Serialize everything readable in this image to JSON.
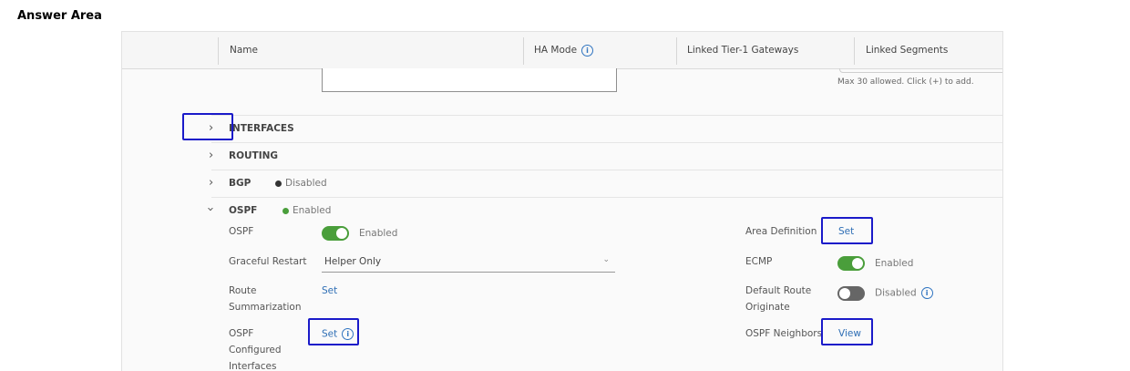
{
  "answer_area_title": "Answer Area",
  "table_header": {
    "name": "Name",
    "ha_mode": "HA Mode",
    "linked_tier1": "Linked Tier-1 Gateways",
    "linked_segments": "Linked Segments"
  },
  "helper_text": "Max 30 allowed. Click (+) to add.",
  "sections": {
    "interfaces": "INTERFACES",
    "routing": "ROUTING",
    "bgp": "BGP",
    "bgp_status": "Disabled",
    "ospf": "OSPF",
    "ospf_status": "Enabled"
  },
  "colors": {
    "enabled": "#4a9e3b",
    "disabled": "#333333",
    "link": "#2f6fb5",
    "highlight": "#1a1ac9"
  },
  "ospf_form": {
    "ospf_label": "OSPF",
    "ospf_toggle_text": "Enabled",
    "graceful_restart_label": "Graceful Restart",
    "graceful_restart_value": "Helper Only",
    "route_summarization_label": "Route Summarization",
    "route_summarization_link": "Set",
    "configured_interfaces_label": "OSPF Configured Interfaces",
    "configured_interfaces_link": "Set",
    "area_definition_label": "Area Definition",
    "area_definition_link": "Set",
    "ecmp_label": "ECMP",
    "ecmp_text": "Enabled",
    "default_route_label": "Default Route Originate",
    "default_route_text": "Disabled",
    "neighbors_label": "OSPF Neighbors",
    "neighbors_link": "View"
  }
}
